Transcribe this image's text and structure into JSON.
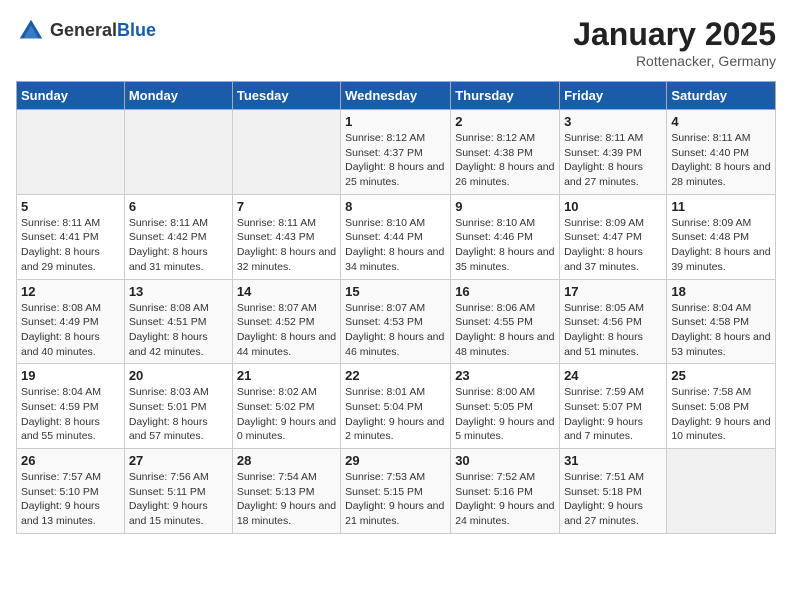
{
  "logo": {
    "general": "General",
    "blue": "Blue"
  },
  "title": "January 2025",
  "location": "Rottenacker, Germany",
  "days_header": [
    "Sunday",
    "Monday",
    "Tuesday",
    "Wednesday",
    "Thursday",
    "Friday",
    "Saturday"
  ],
  "weeks": [
    [
      {
        "day": "",
        "info": ""
      },
      {
        "day": "",
        "info": ""
      },
      {
        "day": "",
        "info": ""
      },
      {
        "day": "1",
        "info": "Sunrise: 8:12 AM\nSunset: 4:37 PM\nDaylight: 8 hours and 25 minutes."
      },
      {
        "day": "2",
        "info": "Sunrise: 8:12 AM\nSunset: 4:38 PM\nDaylight: 8 hours and 26 minutes."
      },
      {
        "day": "3",
        "info": "Sunrise: 8:11 AM\nSunset: 4:39 PM\nDaylight: 8 hours and 27 minutes."
      },
      {
        "day": "4",
        "info": "Sunrise: 8:11 AM\nSunset: 4:40 PM\nDaylight: 8 hours and 28 minutes."
      }
    ],
    [
      {
        "day": "5",
        "info": "Sunrise: 8:11 AM\nSunset: 4:41 PM\nDaylight: 8 hours and 29 minutes."
      },
      {
        "day": "6",
        "info": "Sunrise: 8:11 AM\nSunset: 4:42 PM\nDaylight: 8 hours and 31 minutes."
      },
      {
        "day": "7",
        "info": "Sunrise: 8:11 AM\nSunset: 4:43 PM\nDaylight: 8 hours and 32 minutes."
      },
      {
        "day": "8",
        "info": "Sunrise: 8:10 AM\nSunset: 4:44 PM\nDaylight: 8 hours and 34 minutes."
      },
      {
        "day": "9",
        "info": "Sunrise: 8:10 AM\nSunset: 4:46 PM\nDaylight: 8 hours and 35 minutes."
      },
      {
        "day": "10",
        "info": "Sunrise: 8:09 AM\nSunset: 4:47 PM\nDaylight: 8 hours and 37 minutes."
      },
      {
        "day": "11",
        "info": "Sunrise: 8:09 AM\nSunset: 4:48 PM\nDaylight: 8 hours and 39 minutes."
      }
    ],
    [
      {
        "day": "12",
        "info": "Sunrise: 8:08 AM\nSunset: 4:49 PM\nDaylight: 8 hours and 40 minutes."
      },
      {
        "day": "13",
        "info": "Sunrise: 8:08 AM\nSunset: 4:51 PM\nDaylight: 8 hours and 42 minutes."
      },
      {
        "day": "14",
        "info": "Sunrise: 8:07 AM\nSunset: 4:52 PM\nDaylight: 8 hours and 44 minutes."
      },
      {
        "day": "15",
        "info": "Sunrise: 8:07 AM\nSunset: 4:53 PM\nDaylight: 8 hours and 46 minutes."
      },
      {
        "day": "16",
        "info": "Sunrise: 8:06 AM\nSunset: 4:55 PM\nDaylight: 8 hours and 48 minutes."
      },
      {
        "day": "17",
        "info": "Sunrise: 8:05 AM\nSunset: 4:56 PM\nDaylight: 8 hours and 51 minutes."
      },
      {
        "day": "18",
        "info": "Sunrise: 8:04 AM\nSunset: 4:58 PM\nDaylight: 8 hours and 53 minutes."
      }
    ],
    [
      {
        "day": "19",
        "info": "Sunrise: 8:04 AM\nSunset: 4:59 PM\nDaylight: 8 hours and 55 minutes."
      },
      {
        "day": "20",
        "info": "Sunrise: 8:03 AM\nSunset: 5:01 PM\nDaylight: 8 hours and 57 minutes."
      },
      {
        "day": "21",
        "info": "Sunrise: 8:02 AM\nSunset: 5:02 PM\nDaylight: 9 hours and 0 minutes."
      },
      {
        "day": "22",
        "info": "Sunrise: 8:01 AM\nSunset: 5:04 PM\nDaylight: 9 hours and 2 minutes."
      },
      {
        "day": "23",
        "info": "Sunrise: 8:00 AM\nSunset: 5:05 PM\nDaylight: 9 hours and 5 minutes."
      },
      {
        "day": "24",
        "info": "Sunrise: 7:59 AM\nSunset: 5:07 PM\nDaylight: 9 hours and 7 minutes."
      },
      {
        "day": "25",
        "info": "Sunrise: 7:58 AM\nSunset: 5:08 PM\nDaylight: 9 hours and 10 minutes."
      }
    ],
    [
      {
        "day": "26",
        "info": "Sunrise: 7:57 AM\nSunset: 5:10 PM\nDaylight: 9 hours and 13 minutes."
      },
      {
        "day": "27",
        "info": "Sunrise: 7:56 AM\nSunset: 5:11 PM\nDaylight: 9 hours and 15 minutes."
      },
      {
        "day": "28",
        "info": "Sunrise: 7:54 AM\nSunset: 5:13 PM\nDaylight: 9 hours and 18 minutes."
      },
      {
        "day": "29",
        "info": "Sunrise: 7:53 AM\nSunset: 5:15 PM\nDaylight: 9 hours and 21 minutes."
      },
      {
        "day": "30",
        "info": "Sunrise: 7:52 AM\nSunset: 5:16 PM\nDaylight: 9 hours and 24 minutes."
      },
      {
        "day": "31",
        "info": "Sunrise: 7:51 AM\nSunset: 5:18 PM\nDaylight: 9 hours and 27 minutes."
      },
      {
        "day": "",
        "info": ""
      }
    ]
  ]
}
